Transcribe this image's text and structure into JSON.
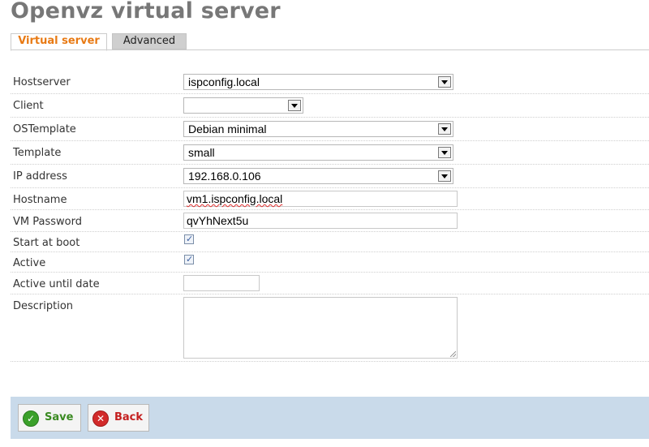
{
  "page": {
    "title": "Openvz virtual server"
  },
  "tabs": [
    {
      "label": "Virtual server",
      "active": true
    },
    {
      "label": "Advanced",
      "active": false
    }
  ],
  "form": {
    "hostserver": {
      "label": "Hostserver",
      "value": "ispconfig.local"
    },
    "client": {
      "label": "Client",
      "value": ""
    },
    "ostemplate": {
      "label": "OSTemplate",
      "value": "Debian minimal"
    },
    "template": {
      "label": "Template",
      "value": "small"
    },
    "ip_address": {
      "label": "IP address",
      "value": "192.168.0.106"
    },
    "hostname": {
      "label": "Hostname",
      "value": "vm1.ispconfig.local"
    },
    "vm_password": {
      "label": "VM Password",
      "value": "qvYhNext5u"
    },
    "start_at_boot": {
      "label": "Start at boot",
      "checked": true
    },
    "active": {
      "label": "Active",
      "checked": true
    },
    "active_until_date": {
      "label": "Active until date",
      "value": ""
    },
    "description": {
      "label": "Description",
      "value": ""
    }
  },
  "buttons": {
    "save": {
      "label": "Save",
      "icon": "check-circle-icon",
      "color": "#3a9a2a"
    },
    "back": {
      "label": "Back",
      "icon": "x-circle-icon",
      "color": "#cc2222"
    }
  },
  "colors": {
    "active_tab": "#e87a14",
    "footer_bar": "#c9daea"
  }
}
